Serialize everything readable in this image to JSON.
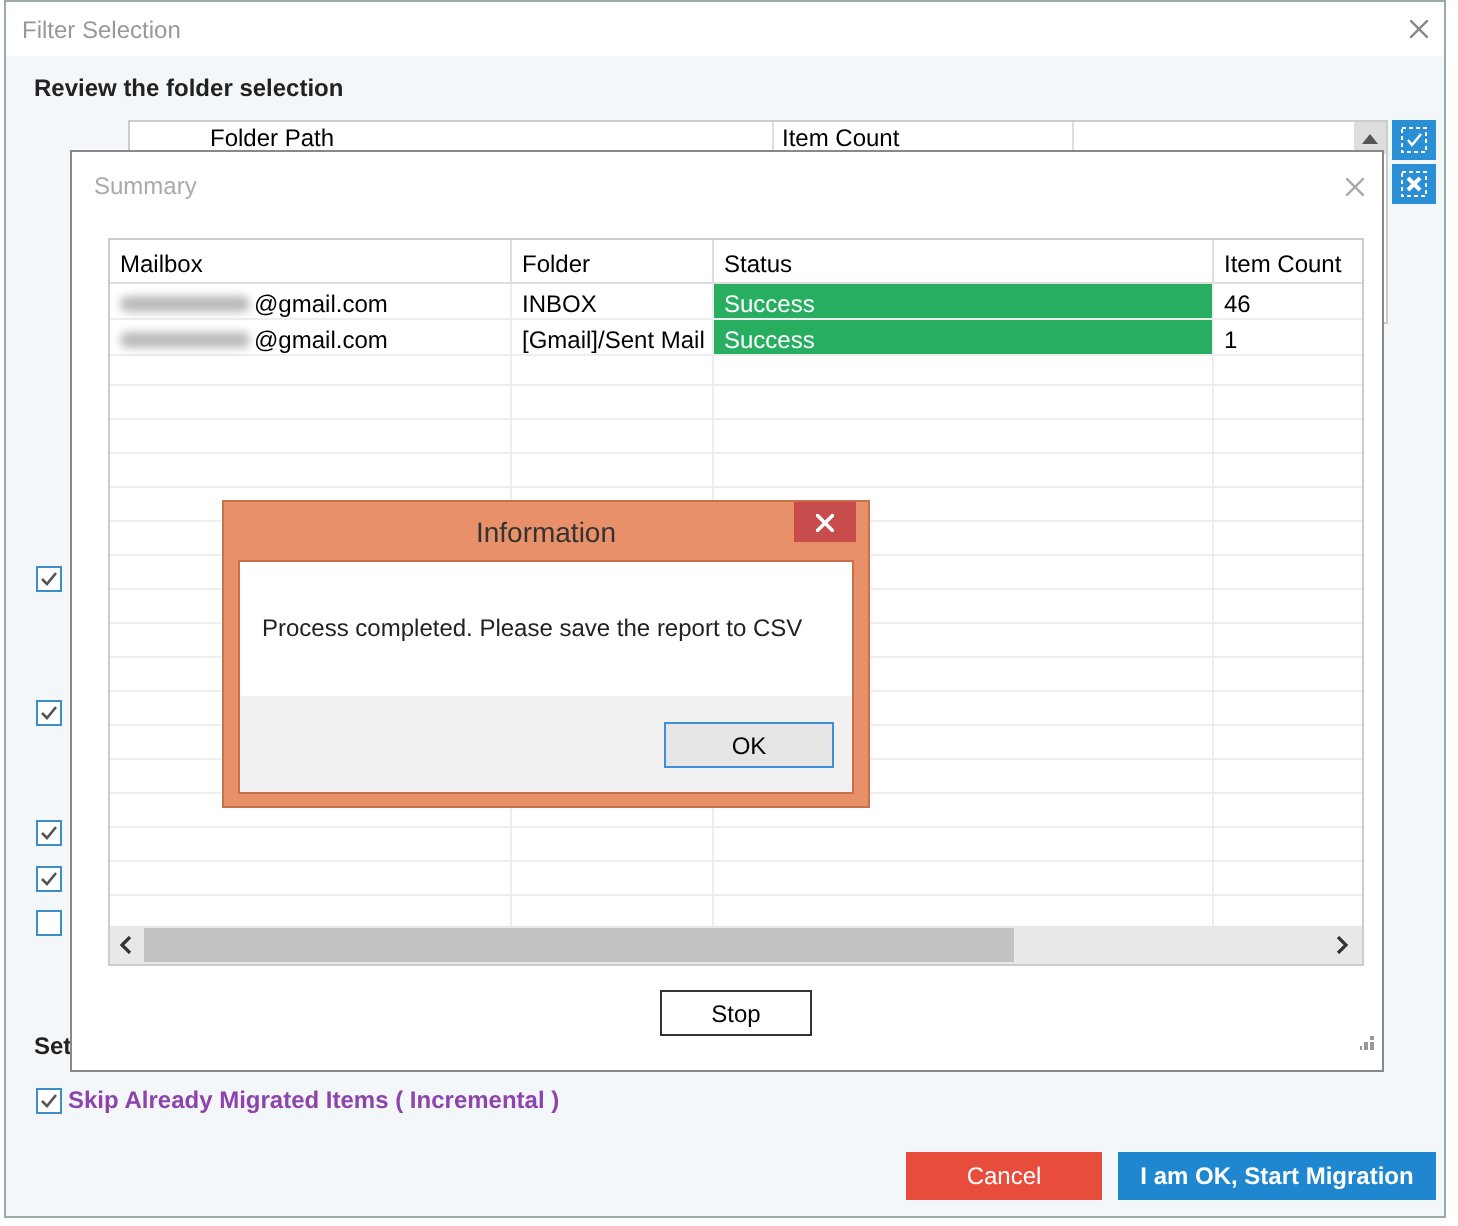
{
  "filter_window": {
    "title": "Filter Selection",
    "heading": "Review the folder selection",
    "folder_table": {
      "columns": [
        "Folder Path",
        "Item Count"
      ]
    },
    "side_checkboxes": [
      {
        "checked": true
      },
      {
        "checked": true
      },
      {
        "checked": true
      },
      {
        "checked": true
      },
      {
        "checked": false
      }
    ],
    "section_label": "Set",
    "incremental_option": {
      "label": "Skip Already Migrated Items ( Incremental )",
      "checked": true
    },
    "buttons": [
      {
        "label": "Cancel",
        "kind": "danger"
      },
      {
        "label": "I am OK, Start Migration",
        "kind": "primary"
      }
    ]
  },
  "summary_window": {
    "title": "Summary",
    "columns": [
      "Mailbox",
      "Folder",
      "Status",
      "Item Count"
    ],
    "rows": [
      {
        "mailbox": "@gmail.com",
        "folder": "INBOX",
        "status": "Success",
        "highlighted": true,
        "item_count": "46"
      },
      {
        "mailbox": "@gmail.com",
        "folder": "[Gmail]/Sent Mail",
        "status": "Success",
        "highlighted": true,
        "item_count": "1"
      }
    ],
    "stop_button": "Stop"
  },
  "info_dialog": {
    "title": "Information",
    "message": "Process completed. Please save the report to CSV",
    "ok_button": "OK"
  }
}
